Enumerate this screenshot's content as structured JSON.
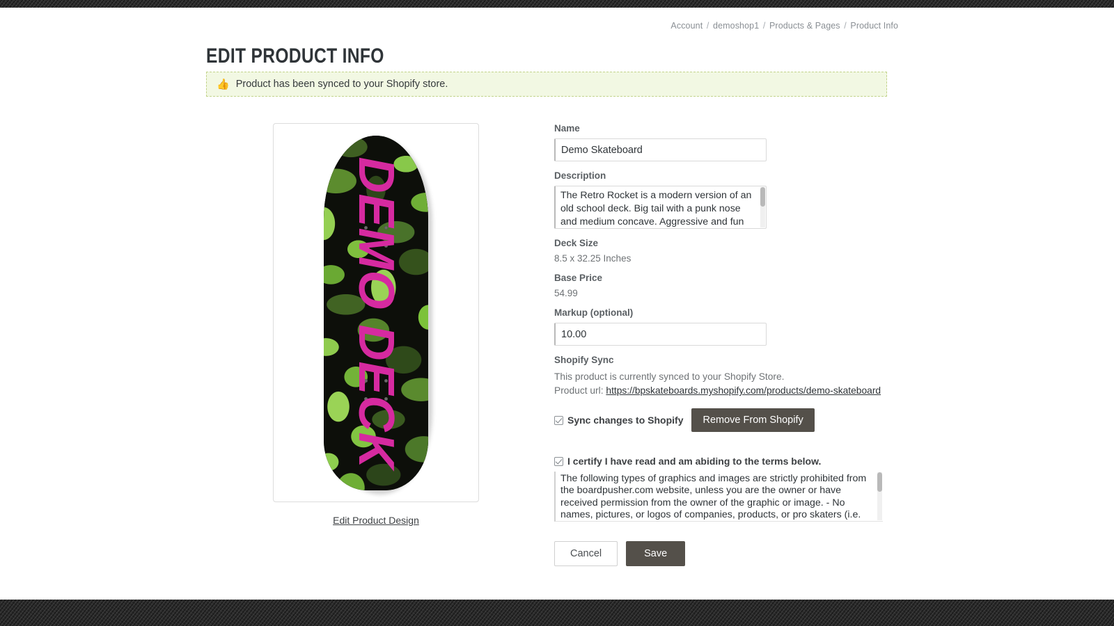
{
  "breadcrumb": {
    "items": [
      "Account",
      "demoshop1",
      "Products & Pages",
      "Product Info"
    ],
    "separator": "/"
  },
  "header": {
    "title": "Edit Product Info"
  },
  "flash": {
    "icon": "thumbs-up-icon",
    "glyph": "👍",
    "message": "Product has been synced to your Shopify store.",
    "background": "#f2f8e3",
    "border_color": "#c2d38a",
    "icon_color": "#6aa21a"
  },
  "preview": {
    "deck_text": "DEMO DECK",
    "deck_text_color": "#d62aa0",
    "camo_colors": [
      "#0d0f0a",
      "#2e471a",
      "#4e7a27",
      "#7cc23a",
      "#9ad356"
    ],
    "edit_design_link": "Edit Product Design"
  },
  "form": {
    "name": {
      "label": "Name",
      "value": "Demo Skateboard",
      "placeholder": "Name"
    },
    "description": {
      "label": "Description",
      "value": "The Retro Rocket is a modern version of an old school deck. Big tail with a punk nose and medium concave. Aggressive and fun all-around"
    },
    "deck_size": {
      "label": "Deck Size",
      "value": "8.5 x 32.25 Inches"
    },
    "base_price": {
      "label": "Base Price",
      "value": "54.99"
    },
    "markup": {
      "label": "Markup (optional)",
      "value": "10.00",
      "placeholder": "0.00"
    },
    "shopify_sync": {
      "label": "Shopify Sync",
      "status_text": "This product is currently synced to your Shopify Store.",
      "url_prefix": "Product url:",
      "url": "https://bpskateboards.myshopify.com/products/demo-skateboard",
      "sync_checkbox_label": "Sync changes to Shopify",
      "sync_checkbox_checked": true,
      "remove_button": "Remove From Shopify"
    },
    "terms": {
      "certify_label": "I certify I have read and am abiding to the terms below.",
      "certify_checked": true,
      "text": "The following types of graphics and images are strictly prohibited from the boardpusher.com website, unless you are the owner or have received permission from the owner of the graphic or image.\n- No names, pictures, or logos of companies, products, or pro skaters (i.e."
    },
    "actions": {
      "cancel": "Cancel",
      "save": "Save"
    }
  }
}
